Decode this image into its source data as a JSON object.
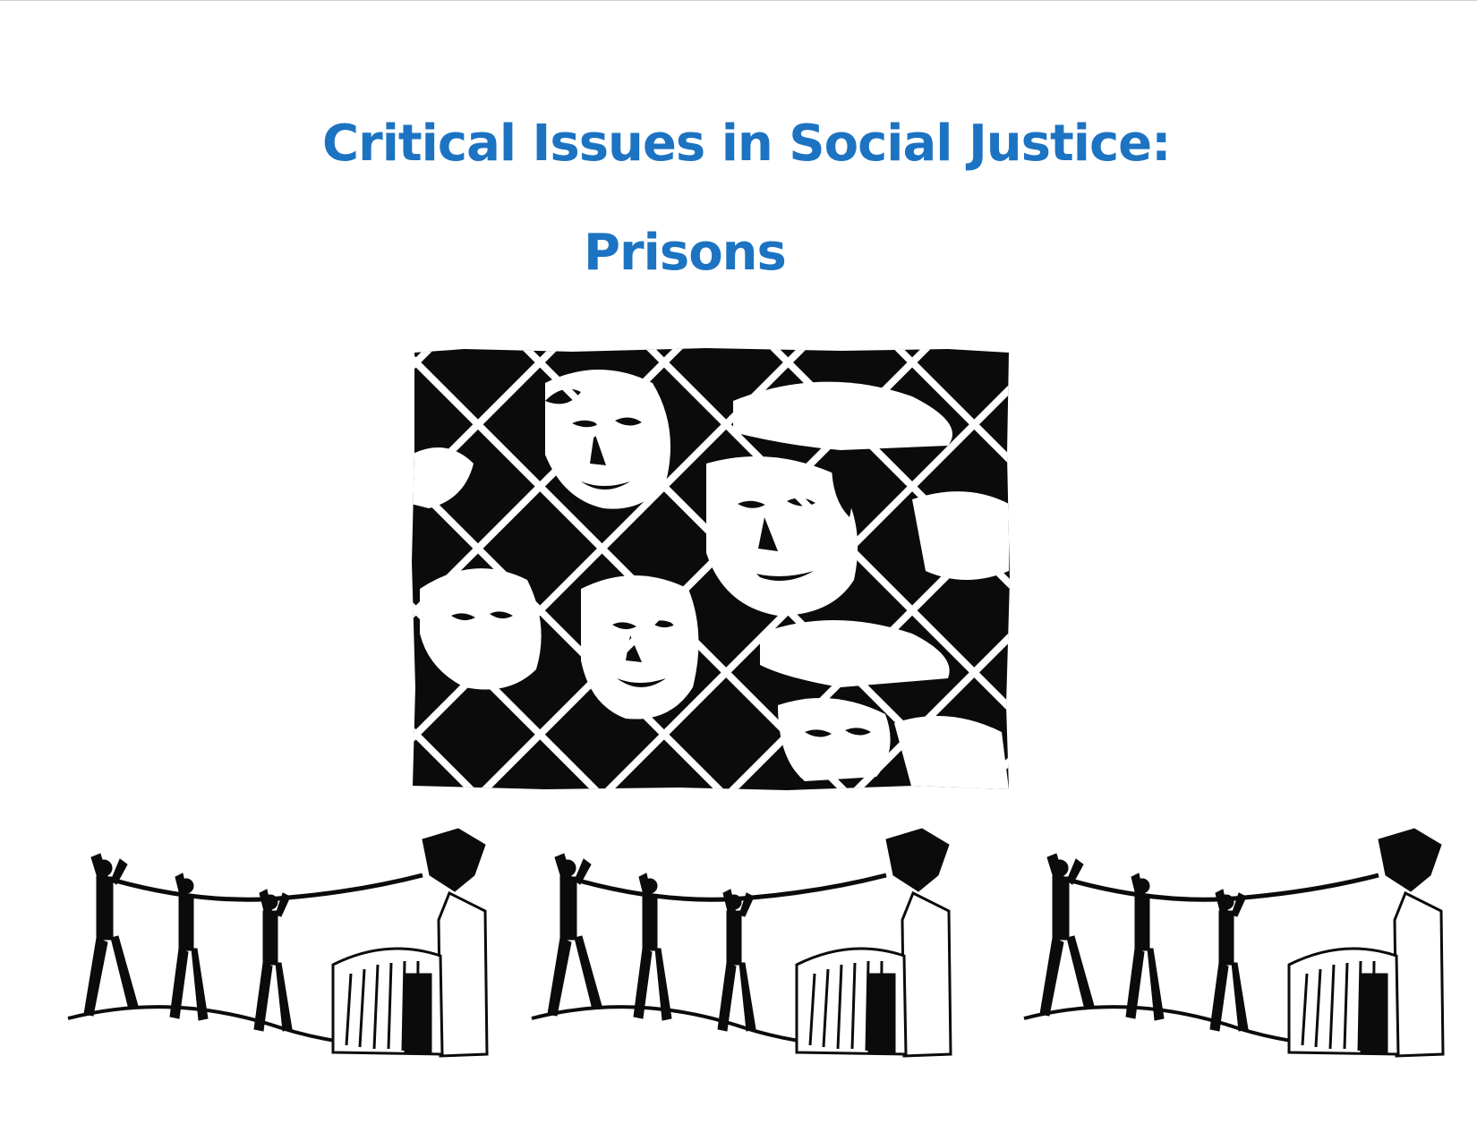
{
  "document": {
    "title": "Critical Issues in Social Justice:",
    "subtitle": "Prisons"
  },
  "colors": {
    "heading": "#1c73c2",
    "ink": "#0b0b0b",
    "paper": "#ffffff"
  },
  "illustrations": {
    "main": "faces-behind-chain-link-fence-woodcut",
    "border_panels": [
      "figures-pulling-rope-toppling-prison",
      "figures-pulling-rope-toppling-prison",
      "figures-pulling-rope-toppling-prison"
    ]
  }
}
